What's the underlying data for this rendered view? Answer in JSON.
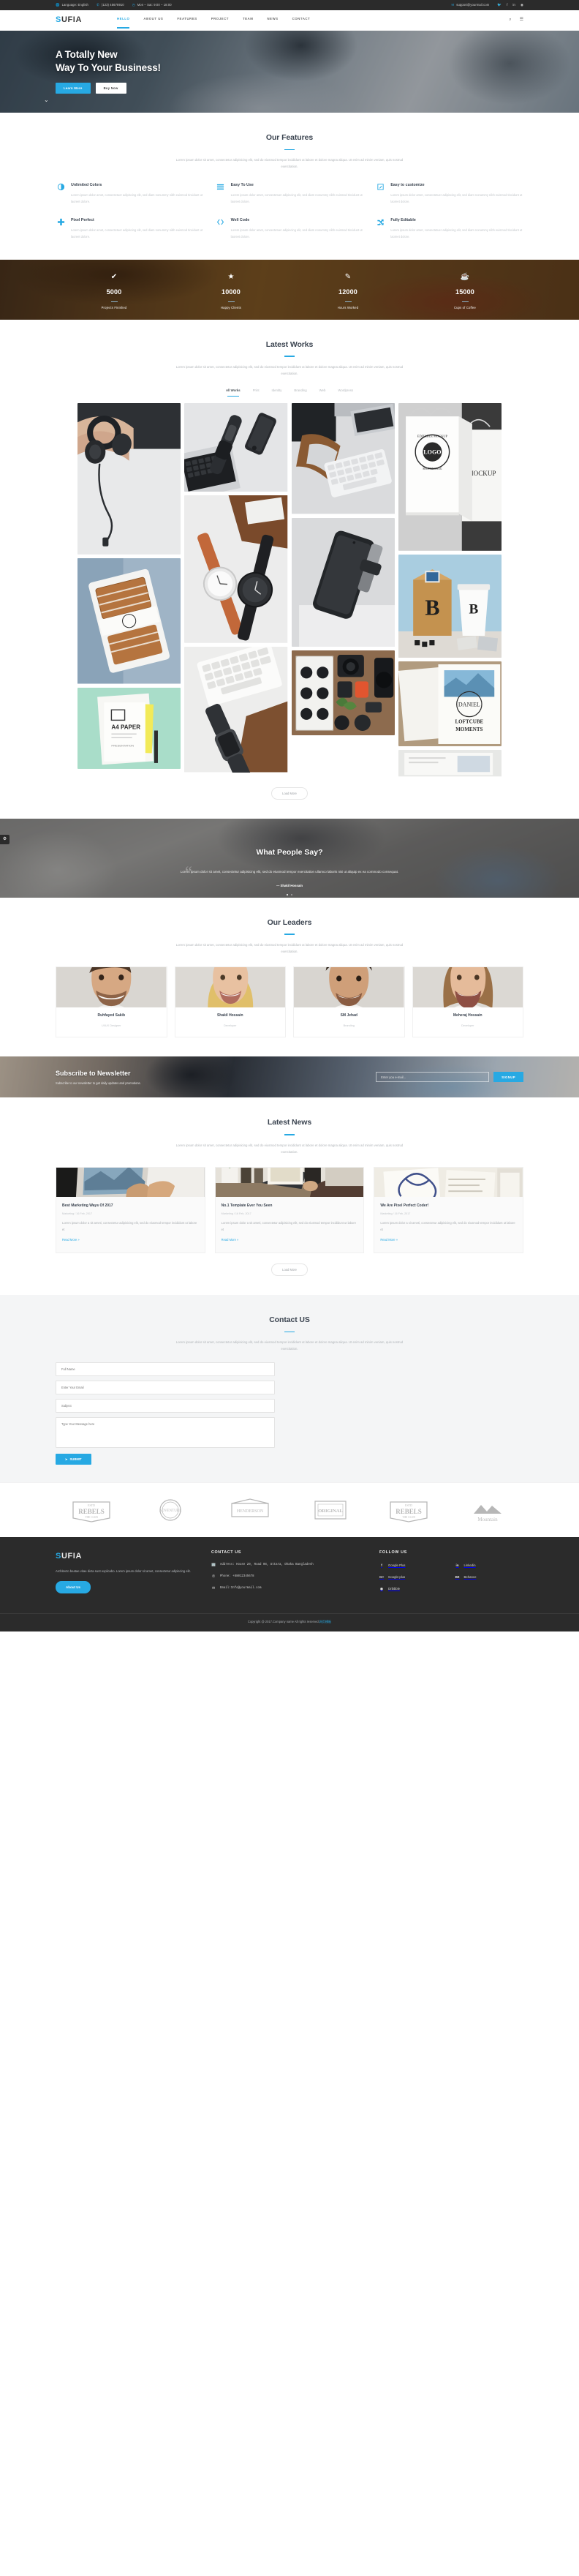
{
  "topbar": {
    "language": "Language: English",
    "phone": "(123) 45678910",
    "hours": "Mon – Sat: 9:00 – 18:00",
    "email": "support@yourmail.com",
    "socials": [
      "twitter-icon",
      "facebook-icon",
      "linkedin-icon",
      "dribbble-icon"
    ]
  },
  "nav": {
    "logo_first": "S",
    "logo_rest": "UFIA",
    "items": [
      {
        "label": "HELLO",
        "active": true
      },
      {
        "label": "ABOUT US",
        "active": false
      },
      {
        "label": "FEATURES",
        "active": false
      },
      {
        "label": "PROJECT",
        "active": false
      },
      {
        "label": "TEAM",
        "active": false
      },
      {
        "label": "NEWS",
        "active": false
      },
      {
        "label": "CONTACT",
        "active": false
      }
    ]
  },
  "hero": {
    "line1": "A Totally New",
    "line2": "Way To Your Business!",
    "btn_primary": "Learn More",
    "btn_ghost": "Buy Now"
  },
  "features": {
    "title": "Our Features",
    "subtitle": "Lorem ipsum dolor sit amet, consectetur adipisicing elit, sed do eiusmod tempor incididunt ut labore et dolore magna aliqua. Ut enim ad minim veniam, quis nostrud exercitation.",
    "items": [
      {
        "icon": "contrast-icon",
        "title": "Unlimited Colors",
        "text": "Lorem ipsum dolor amet, consectetuer adipiscing elit, sed diam nonummy nibh euismod tincidunt ut laoreet dolore."
      },
      {
        "icon": "bars-icon",
        "title": "Easy To Use",
        "text": "Lorem ipsum dolor amet, consectetuer adipiscing elit, sed diam nonummy nibh euismod tincidunt ut laoreet dolore."
      },
      {
        "icon": "pencil-square-icon",
        "title": "Easy to customize",
        "text": "Lorem ipsum dolor amet, consectetuer adipiscing elit, sed diam nonummy nibh euismod tincidunt ut laoreet dolore."
      },
      {
        "icon": "plus-icon",
        "title": "Pixel Perfect",
        "text": "Lorem ipsum dolor amet, consectetuer adipiscing elit, sed diam nonummy nibh euismod tincidunt ut laoreet dolore."
      },
      {
        "icon": "code-icon",
        "title": "Well Code",
        "text": "Lorem ipsum dolor amet, consectetuer adipiscing elit, sed diam nonummy nibh euismod tincidunt ut laoreet dolore."
      },
      {
        "icon": "random-icon",
        "title": "Fully Editable",
        "text": "Lorem ipsum dolor amet, consectetuer adipiscing elit, sed diam nonummy nibh euismod tincidunt ut laoreet dolore."
      }
    ]
  },
  "counters": [
    {
      "icon": "check-icon",
      "glyph": "✔",
      "value": "5000",
      "label": "Projects Finished"
    },
    {
      "icon": "star-icon",
      "glyph": "★",
      "value": "10000",
      "label": "Happy Clients"
    },
    {
      "icon": "pencil-square-icon",
      "glyph": "✎",
      "value": "12000",
      "label": "Hours Worked"
    },
    {
      "icon": "coffee-cup-icon",
      "glyph": "☕",
      "value": "15000",
      "label": "Cups of Coffee"
    }
  ],
  "works": {
    "title": "Latest Works",
    "subtitle": "Lorem ipsum dolor sit amet, consectetur adipisicing elit, sed do eiusmod tempor incididunt ut labore et dolore magna aliqua. Ut enim ad minim veniam, quis nostrud exercitation.",
    "filters": [
      {
        "label": "All Works",
        "active": true
      },
      {
        "label": "Print",
        "active": false
      },
      {
        "label": "Identity",
        "active": false
      },
      {
        "label": "Branding",
        "active": false
      },
      {
        "label": "Web",
        "active": false
      },
      {
        "label": "Wordpress",
        "active": false
      }
    ],
    "load_more": "Load More"
  },
  "testimonial": {
    "title": "What People Say?",
    "quote": "Lorem ipsum dolor sit amet, consectetur adipisicing elit, sed do eiusmod tempor exercitation ullamco laboris nisi ut aliquip ex ea commodo consequat.",
    "author": "— Shakil Hossain",
    "quote_mark": "“"
  },
  "team": {
    "title": "Our Leaders",
    "subtitle": "Lorem ipsum dolor sit amet, consectetur adipisicing elit, sed do eiusmod tempor incididunt ut labore et dolore magna aliqua. Ut enim ad minim veniam, quis nostrud exercitation.",
    "members": [
      {
        "name": "Ruhfayed Sakib",
        "role": "UI/UX Designer"
      },
      {
        "name": "Shakil Hossain",
        "role": "Developer"
      },
      {
        "name": "SM Jehad",
        "role": "Branding"
      },
      {
        "name": "Meheraj Hossain",
        "role": "Developer"
      }
    ]
  },
  "newsletter": {
    "title": "Subscribe to Newsletter",
    "subtitle": "Subscribe to our newsletter to get daily updates and promotions.",
    "placeholder": "Enter you e-mail...",
    "button": "SIGNUP"
  },
  "blog": {
    "title": "Latest News",
    "subtitle": "Lorem ipsum dolor sit amet, consectetur adipisicing elit, sed do eiusmod tempor incididunt ut labore et dolore magna aliqua. Ut enim ad minim veniam, quis nostrud exercitation.",
    "posts": [
      {
        "title": "Best Marketing Ways Of 2017",
        "meta": "Marketing / 16 Feb, 2017",
        "excerpt": "Lorem ipsum dolor a sit ameti, consectetur adipisicing elit, sed do eiusmod tempor incididunt ut labore et",
        "link": "Read More »"
      },
      {
        "title": "No.1 Template Ever You Seen",
        "meta": "Marketing / 16 Feb, 2017",
        "excerpt": "Lorem ipsum dolor a sit ameti, consectetur adipisicing elit, sed do eiusmod tempor incididunt ut labore et",
        "link": "Read More »"
      },
      {
        "title": "We Are Pixel Perfect Coder!",
        "meta": "Marketing / 16 Feb, 2017",
        "excerpt": "Lorem ipsum dolor a sit ameti, consectetur adipisicing elit, sed do eiusmod tempor incididunt ut labore et",
        "link": "Read More »"
      }
    ],
    "load_more": "Load More"
  },
  "contact": {
    "title": "Contact US",
    "subtitle": "Lorem ipsum dolor sit amet, consectetur adipisicing elit, sed do eiusmod tempor incididunt ut labore et dolore magna aliqua. Ut enim ad minim veniam, quis nostrud exercitation.",
    "name_placeholder": "Full Name",
    "email_placeholder": "Enter Your Email",
    "subject_placeholder": "Subject",
    "message_placeholder": "Type Your Message here",
    "submit": "SUBMIT"
  },
  "clients": [
    {
      "name": "REBELS",
      "sub": "THE CLUB",
      "top": "ESTD"
    },
    {
      "name": "ADVENTURE",
      "sub": "",
      "top": ""
    },
    {
      "name": "HENDERSON",
      "sub": "",
      "top": ""
    },
    {
      "name": "ORIGINAL",
      "sub": "",
      "top": ""
    },
    {
      "name": "REBELS",
      "sub": "THE CLUB",
      "top": "ESTD"
    },
    {
      "name": "Mountain",
      "sub": "",
      "top": ""
    }
  ],
  "footer": {
    "logo_first": "S",
    "logo_rest": "UFIA",
    "description": "Architecto beatae vitae dicta sunt explicabo. Lorem ipsum dolor sit amet, consectetur adipiscing elit.",
    "about_button": "About Us",
    "contact_title": "CONTACT US",
    "address": "Address: House 20, Road 08, Uttara, Dhaka Bangladesh",
    "phone": "Phone: +88012345678",
    "email": "Email:Info@yourmail.com",
    "follow_title": "FOLLOW US",
    "socials": [
      {
        "icon": "facebook-icon",
        "glyph": "f",
        "label": "Google Plus"
      },
      {
        "icon": "linkedin-icon",
        "glyph": "in",
        "label": "Linkedin"
      },
      {
        "icon": "google-plus-icon",
        "glyph": "G+",
        "label": "Google-plus"
      },
      {
        "icon": "behance-icon",
        "glyph": "Bē",
        "label": "Behance"
      },
      {
        "icon": "dribbble-icon",
        "glyph": "◉",
        "label": "Dribbble"
      }
    ],
    "copyright": "Copyright @ 2017.Company name All rights reserved.",
    "copyright_accent": "网页模板"
  },
  "colors": {
    "accent": "#27a9e3",
    "dark": "#2b2b2b",
    "heading": "#3b4450"
  }
}
